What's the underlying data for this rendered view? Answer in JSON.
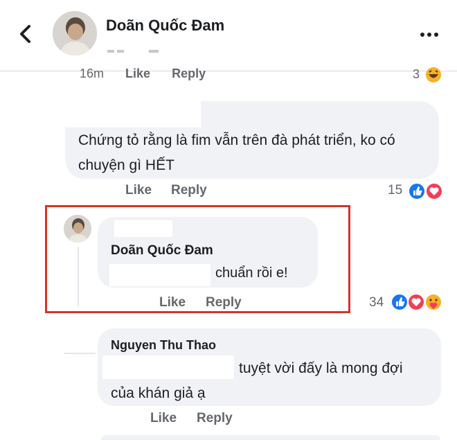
{
  "header": {
    "title": "Doãn Quốc Đam",
    "back_icon": "chevron-left-icon",
    "more_icon": "more-dots-icon"
  },
  "partial_comment": {
    "time": "16m",
    "like_label": "Like",
    "reply_label": "Reply",
    "reaction_count": "3",
    "reaction_icon": "haha-icon"
  },
  "comments": [
    {
      "text": "Chứng tỏ rằng là fim vẫn trên đà phát triển, ko có chuyện gì HẾT",
      "like_label": "Like",
      "reply_label": "Reply",
      "reaction_count": "15",
      "reactions": [
        "like-icon",
        "love-icon"
      ]
    },
    {
      "author": "Doãn Quốc Đam",
      "text": "chuẩn rồi e!",
      "like_label": "Like",
      "reply_label": "Reply",
      "reaction_count": "34",
      "reactions": [
        "like-icon",
        "love-icon",
        "care-icon"
      ]
    },
    {
      "author": "Nguyen Thu Thao",
      "text": "tuyệt vời đấy là mong đợi của khán giả ạ",
      "text_line1": "tuyệt vời đấy là mong đợi",
      "text_line2": "của khán giả ạ",
      "like_label": "Like",
      "reply_label": "Reply"
    }
  ],
  "colors": {
    "bubble": "#f0f2f5",
    "highlight_border": "#d6322b",
    "like_blue": "#1877f2",
    "love_red": "#f33e58",
    "care_yellow": "#f7b125"
  }
}
